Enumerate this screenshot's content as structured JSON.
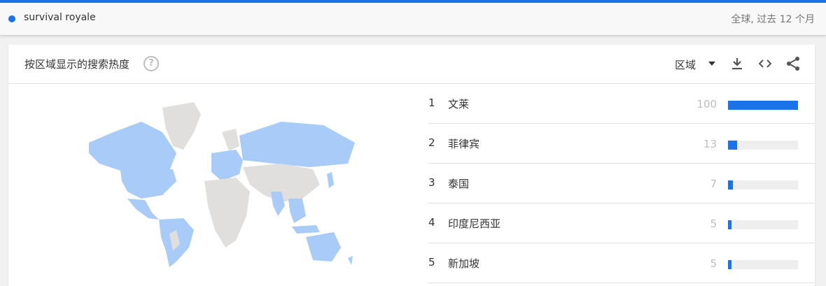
{
  "term": {
    "label": "survival royale",
    "scope": "全球, 过去 12 个月",
    "color": "#1a73e8"
  },
  "card": {
    "title": "按区域显示的搜索热度",
    "help_icon": "?",
    "region_select": "区域",
    "icons": [
      "download-icon",
      "embed-icon",
      "share-icon"
    ]
  },
  "ranking": [
    {
      "rank": "1",
      "name": "文莱",
      "value": 100
    },
    {
      "rank": "2",
      "name": "菲律宾",
      "value": 13
    },
    {
      "rank": "3",
      "name": "泰国",
      "value": 7
    },
    {
      "rank": "4",
      "name": "印度尼西亚",
      "value": 5
    },
    {
      "rank": "5",
      "name": "新加坡",
      "value": 5
    }
  ],
  "colors": {
    "bar": "#1a73e8",
    "track": "#eeeeee",
    "map_active": "#a8cbf8",
    "map_inactive": "#e0dfde"
  }
}
